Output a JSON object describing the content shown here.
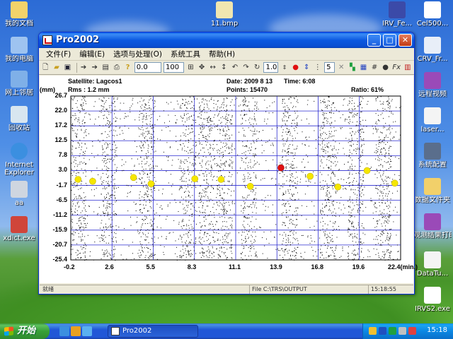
{
  "desktop": {
    "icons": [
      {
        "name": "my-documents",
        "label": "我的文档",
        "color": "#f3d36a"
      },
      {
        "name": "my-computer",
        "label": "我的电脑",
        "color": "#9ec3f0"
      },
      {
        "name": "network-places",
        "label": "网上邻居",
        "color": "#7fb0e8"
      },
      {
        "name": "recycle-bin",
        "label": "回收站",
        "color": "#d8e6f0"
      },
      {
        "name": "internet-explorer",
        "label": "Internet Explorer",
        "color": "#3b8fe0"
      },
      {
        "name": "aa",
        "label": "aa",
        "color": "#cfd6e0"
      },
      {
        "name": "xdict",
        "label": "xdict.exe",
        "color": "#d0453a"
      },
      {
        "name": "bmp-file",
        "label": "11.bmp",
        "color": "#f0e6b0"
      },
      {
        "name": "irv-fe",
        "label": "IRV_Fe...",
        "color": "#3b4aa8"
      },
      {
        "name": "cel500",
        "label": "Cel500...",
        "color": "#ffffff"
      },
      {
        "name": "crv-fr",
        "label": "CRV_Fr...",
        "color": "#e8eef8"
      },
      {
        "name": "remote-video",
        "label": "远程视频",
        "color": "#9a4ab8"
      },
      {
        "name": "laser",
        "label": "laser...",
        "color": "#f4f4f4"
      },
      {
        "name": "sys-config",
        "label": "系统配置",
        "color": "#5a6e8c"
      },
      {
        "name": "folder-irs",
        "label": "数据文件夹",
        "color": "#f2d06a"
      },
      {
        "name": "obs-print",
        "label": "观测结果打印",
        "color": "#9a4ab8"
      },
      {
        "name": "datatu",
        "label": "DataTu...",
        "color": "#f4f4f4"
      },
      {
        "name": "irvs2",
        "label": "IRVS2.exe",
        "color": "#ffffff"
      }
    ]
  },
  "window": {
    "title": "Pro2002",
    "buttons": {
      "minimize": "_",
      "maximize": "□",
      "close": "✕"
    },
    "menu": [
      "文件(F)",
      "编辑(E)",
      "选项与处理(O)",
      "系统工具",
      "帮助(H)"
    ],
    "toolbar": {
      "field1": "0.0",
      "field2": "100",
      "field3": "1.0",
      "field4": "5"
    }
  },
  "plot_header": {
    "satellite": "Satellite: Lagcos1",
    "date": "Date: 2009  8 13",
    "time": "Time: 6:08",
    "unit": "(mm)",
    "rms": "Rms :   1.2 mm",
    "points": "Points: 15470",
    "ratio": "Ratio:  61%"
  },
  "chart_data": {
    "type": "scatter",
    "title": "",
    "ylabel": "(mm)",
    "xlabel": "(min.)",
    "y_ticks": [
      "26.7",
      "22.0",
      "17.2",
      "12.5",
      "7.8",
      "3.0",
      "-1.7",
      "-6.5",
      "-11.2",
      "-15.9",
      "-20.7",
      "-25.4"
    ],
    "x_ticks": [
      "-0.2",
      "2.6",
      "5.5",
      "8.3",
      "11.1",
      "13.9",
      "16.8",
      "19.6",
      "22.4(min.)"
    ],
    "xlim": [
      -0.2,
      22.4
    ],
    "ylim": [
      -25.4,
      26.7
    ],
    "grid": true,
    "point_color": "#000000",
    "marker_color": "#f5e600",
    "highlight_color": "#e01010",
    "noise_point_count": 15470,
    "dense_bands_x": [
      0.3,
      2.4,
      5.0,
      7.8,
      9.1,
      10.3,
      12.0,
      14.8,
      17.4,
      19.3,
      21.2
    ],
    "markers": [
      {
        "x": 0.3,
        "y": 0.2
      },
      {
        "x": 1.3,
        "y": -0.4
      },
      {
        "x": 4.1,
        "y": 0.8
      },
      {
        "x": 5.3,
        "y": -1.2
      },
      {
        "x": 8.3,
        "y": 0.4
      },
      {
        "x": 10.1,
        "y": 0.2
      },
      {
        "x": 12.1,
        "y": -2.0
      },
      {
        "x": 16.2,
        "y": 1.2
      },
      {
        "x": 18.1,
        "y": -2.2
      },
      {
        "x": 20.1,
        "y": 3.0
      },
      {
        "x": 22.0,
        "y": -1.0
      }
    ],
    "highlight": {
      "x": 14.2,
      "y": 3.9
    }
  },
  "statusbar": {
    "left": "就绪",
    "file": "File  C:\\TRS\\OUTPUT",
    "time": "15:18:55"
  },
  "taskbar": {
    "start_label": "开始",
    "task": "Pro2002",
    "clock": "15:18"
  }
}
